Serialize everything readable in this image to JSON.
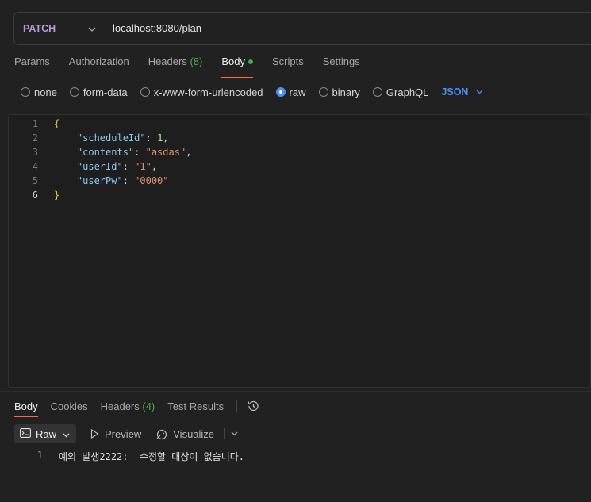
{
  "request": {
    "method": "PATCH",
    "url": "localhost:8080/plan"
  },
  "request_tabs": [
    {
      "label": "Params"
    },
    {
      "label": "Authorization"
    },
    {
      "label": "Headers",
      "count": "(8)"
    },
    {
      "label": "Body",
      "active": true
    },
    {
      "label": "Scripts"
    },
    {
      "label": "Settings"
    }
  ],
  "body_types": [
    {
      "label": "none",
      "checked": false
    },
    {
      "label": "form-data",
      "checked": false
    },
    {
      "label": "x-www-form-urlencoded",
      "checked": false
    },
    {
      "label": "raw",
      "checked": true
    },
    {
      "label": "binary",
      "checked": false
    },
    {
      "label": "GraphQL",
      "checked": false
    }
  ],
  "format_selector": "JSON",
  "editor": {
    "line_numbers": [
      "1",
      "2",
      "3",
      "4",
      "5",
      "6"
    ],
    "lines": [
      {
        "open": "{"
      },
      {
        "key": "\"scheduleId\"",
        "colon": ": ",
        "value": "1",
        "value_type": "num",
        "trail": ","
      },
      {
        "key": "\"contents\"",
        "colon": ": ",
        "value": "\"asdas\"",
        "value_type": "str",
        "trail": ","
      },
      {
        "key": "\"userId\"",
        "colon": ": ",
        "value": "\"1\"",
        "value_type": "str",
        "trail": ","
      },
      {
        "key": "\"userPw\"",
        "colon": ": ",
        "value": "\"0000\"",
        "value_type": "str",
        "trail": ""
      },
      {
        "close": "}"
      }
    ]
  },
  "response_tabs": [
    {
      "label": "Body",
      "active": true
    },
    {
      "label": "Cookies"
    },
    {
      "label": "Headers",
      "count": "(4)"
    },
    {
      "label": "Test Results"
    }
  ],
  "response_toolbar": {
    "raw_label": "Raw",
    "preview_label": "Preview",
    "visualize_label": "Visualize"
  },
  "response_body": {
    "line_number": "1",
    "text": "예외 발생2222:  수정할 대상이 없습니다."
  },
  "icons": {
    "method_dropdown": "chevron-down-icon",
    "history": "history-icon",
    "raw": "text-lines-icon",
    "preview": "play-icon",
    "visualize": "visualize-icon"
  },
  "colors": {
    "method": "#b39ddb",
    "active_tab_underline": "#ff6c37",
    "count_green": "#4caf50",
    "radio_selected": "#4a90f0",
    "json_key": "#8fc6f0",
    "json_string": "#e0916f",
    "json_number": "#b5e3a8"
  }
}
